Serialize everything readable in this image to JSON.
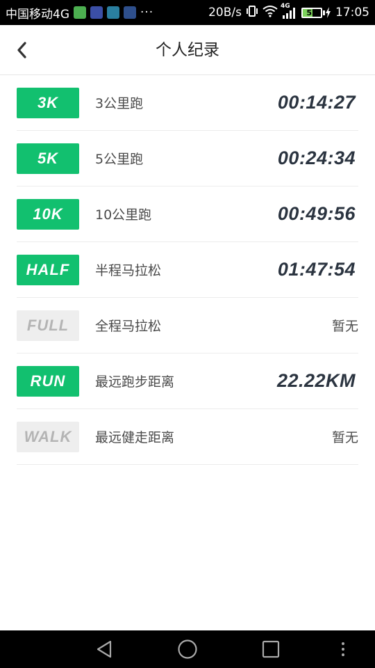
{
  "status_bar": {
    "carrier": "中国移动4G",
    "app_icons": [
      "wechat-icon",
      "app-icon-2",
      "app-icon-3",
      "usb-icon"
    ],
    "more": "···",
    "net_speed": "20B/s",
    "network_type": "4G",
    "battery_level": "52",
    "time": "17:05"
  },
  "header": {
    "title": "个人纪录",
    "back_icon": "chevron-left-icon"
  },
  "records": [
    {
      "badge": "3K",
      "label": "3公里跑",
      "value": "00:14:27",
      "achieved": true
    },
    {
      "badge": "5K",
      "label": "5公里跑",
      "value": "00:24:34",
      "achieved": true
    },
    {
      "badge": "10K",
      "label": "10公里跑",
      "value": "00:49:56",
      "achieved": true
    },
    {
      "badge": "HALF",
      "label": "半程马拉松",
      "value": "01:47:54",
      "achieved": true
    },
    {
      "badge": "FULL",
      "label": "全程马拉松",
      "value": "暂无",
      "achieved": false
    },
    {
      "badge": "RUN",
      "label": "最远跑步距离",
      "value": "22.22KM",
      "achieved": true
    },
    {
      "badge": "WALK",
      "label": "最远健走距离",
      "value": "暂无",
      "achieved": false
    }
  ],
  "colors": {
    "accent": "#12c06f",
    "inactive_badge": "#eeeeee",
    "value_text": "#2b3440"
  },
  "nav_bar": {
    "buttons": [
      "back-triangle-icon",
      "home-circle-icon",
      "recents-square-icon",
      "menu-dots-icon"
    ]
  }
}
